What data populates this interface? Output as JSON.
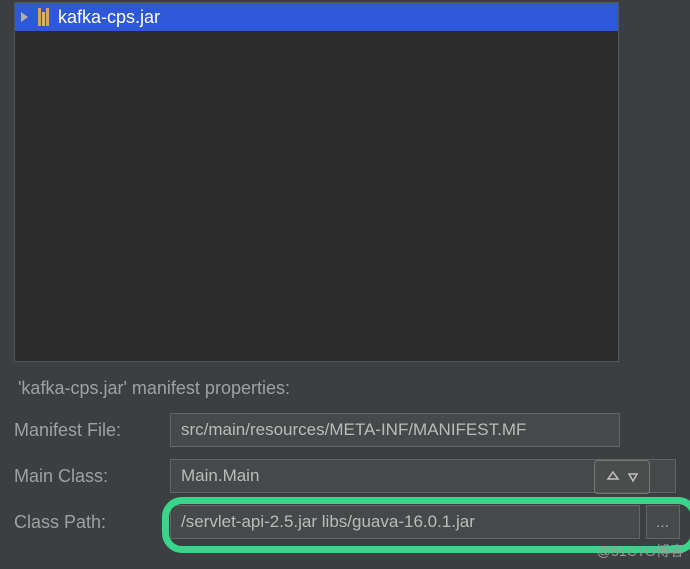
{
  "tree": {
    "selected_item": "kafka-cps.jar"
  },
  "properties": {
    "title": "'kafka-cps.jar' manifest properties:",
    "manifest_file": {
      "label": "Manifest File:",
      "value": "src/main/resources/META-INF/MANIFEST.MF"
    },
    "main_class": {
      "label": "Main Class:",
      "value": "Main.Main"
    },
    "class_path": {
      "label": "Class Path:",
      "value": "/servlet-api-2.5.jar libs/guava-16.0.1.jar",
      "browse": "…"
    }
  },
  "watermark": "@51CTO博客"
}
